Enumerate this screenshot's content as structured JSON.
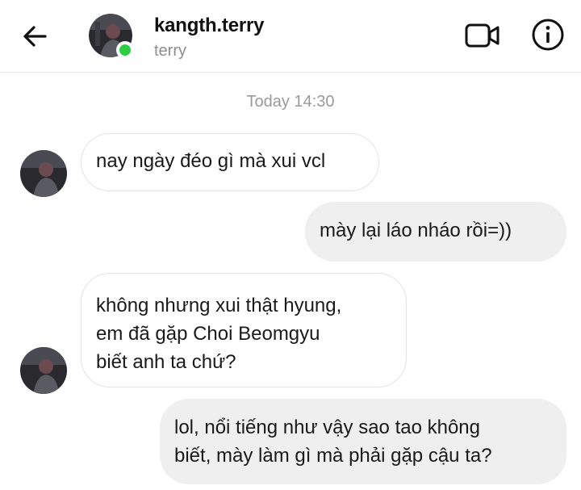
{
  "header": {
    "username": "kangth.terry",
    "subname": "terry",
    "online_color": "#2ecc40",
    "back_icon": "arrow-left-icon",
    "video_icon": "video-call-icon",
    "info_icon": "info-icon"
  },
  "timestamp": "Today 14:30",
  "messages": [
    {
      "direction": "incoming",
      "text": "nay ngày đéo gì mà xui vcl"
    },
    {
      "direction": "outgoing",
      "text": "mày lại láo nháo rồi=))"
    },
    {
      "direction": "incoming",
      "text": "không nhưng xui thật hyung,\nem đã gặp Choi Beomgyu\nbiết anh ta chứ?"
    },
    {
      "direction": "outgoing",
      "text": "lol, nổi tiếng như vậy sao tao không\nbiết, mày làm gì mà phải gặp cậu ta?"
    }
  ]
}
